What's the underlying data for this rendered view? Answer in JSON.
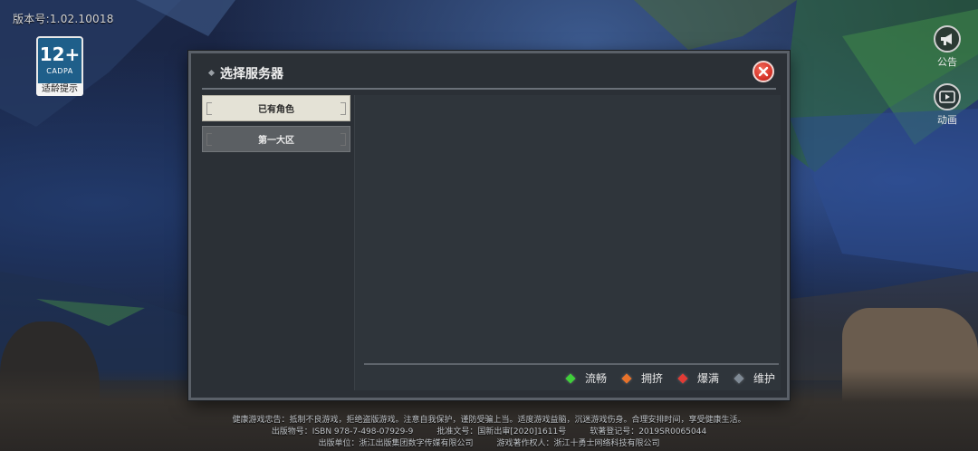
{
  "version_text": "版本号:1.02.10018",
  "age_rating": {
    "number": "12+",
    "org": "CADPA",
    "tip": "适龄提示"
  },
  "side_buttons": {
    "notice_label": "公告",
    "video_label": "动画"
  },
  "dialog": {
    "title": "选择服务器",
    "tabs": [
      {
        "label": "已有角色",
        "active": true
      },
      {
        "label": "第一大区",
        "active": false
      }
    ],
    "legend": [
      {
        "label": "流畅",
        "color": "#3fcf3a"
      },
      {
        "label": "拥挤",
        "color": "#e8722a"
      },
      {
        "label": "爆满",
        "color": "#e23b35"
      },
      {
        "label": "维护",
        "color": "#7f8a95"
      }
    ]
  },
  "footer": {
    "line1": "健康游戏忠告：抵制不良游戏，拒绝盗版游戏。注意自我保护，谨防受骗上当。适度游戏益脑，沉迷游戏伤身。合理安排时间，享受健康生活。",
    "isbn": "出版物号：ISBN 978-7-498-07929-9",
    "approval": "批准文号：国新出审[2020]1611号",
    "software_reg": "软著登记号：2019SR0065044",
    "publisher": "出版单位：浙江出版集团数字传媒有限公司",
    "copyright": "游戏著作权人：浙江十勇士网络科技有限公司"
  },
  "colors": {
    "dialog_bg": "#2b3036",
    "tab_active_bg": "#e4e2d6",
    "tab_inactive_bg": "#5b5f63",
    "close_red": "#d9362b",
    "badge_blue": "#1f5f8a"
  }
}
